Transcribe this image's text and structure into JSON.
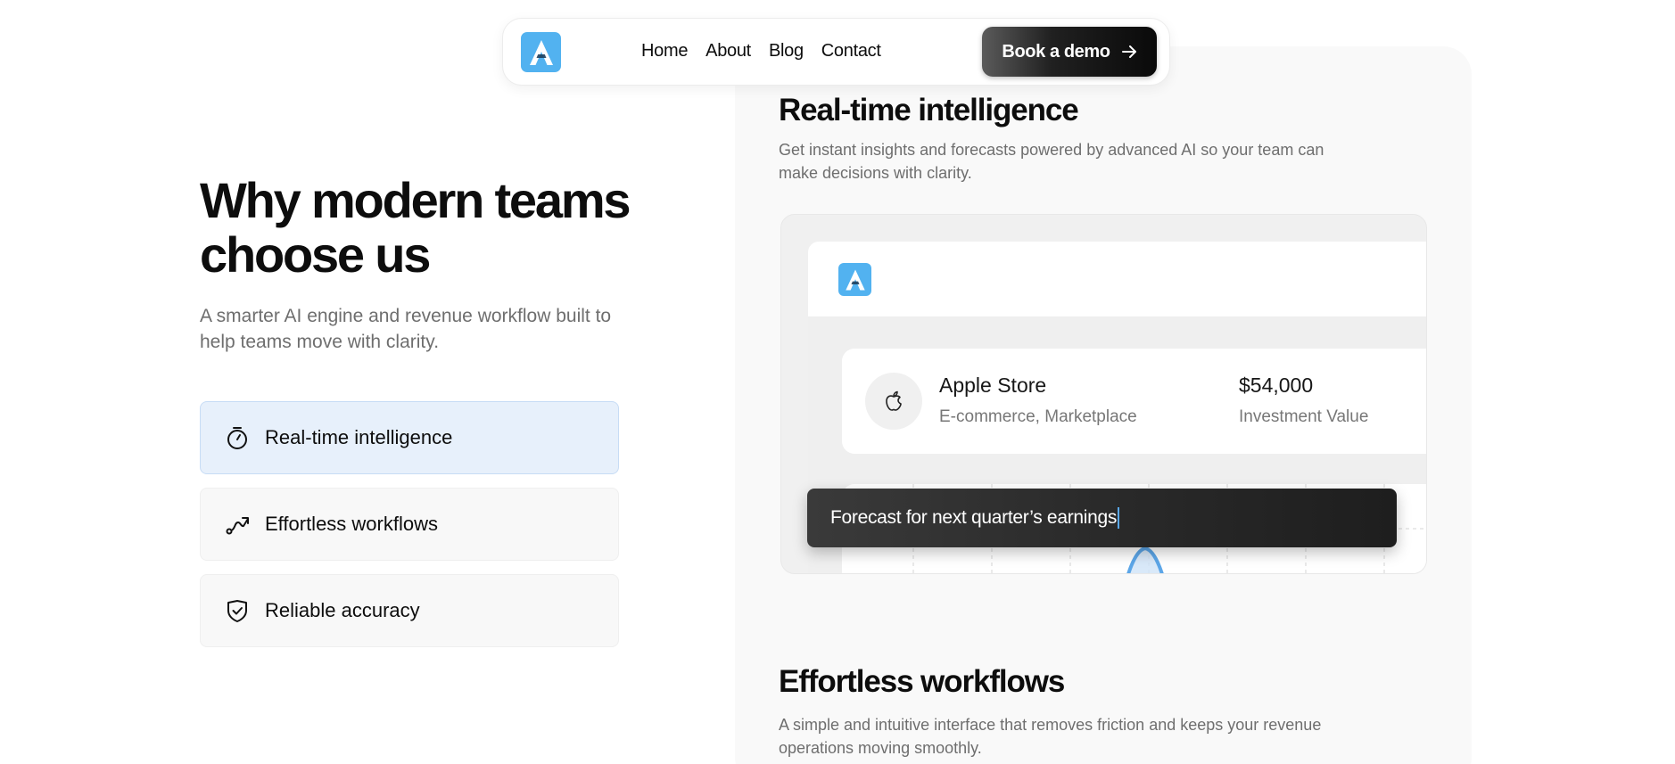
{
  "nav": {
    "links": [
      "Home",
      "About",
      "Blog",
      "Contact"
    ],
    "cta_label": "Book a demo"
  },
  "hero": {
    "title": "Why modern teams choose us",
    "subtitle": "A smarter AI engine and revenue workflow built to help teams move with clarity."
  },
  "features": [
    {
      "label": "Real-time intelligence",
      "icon": "stopwatch-icon",
      "active": true
    },
    {
      "label": "Effortless workflows",
      "icon": "route-arrow-icon",
      "active": false
    },
    {
      "label": "Reliable accuracy",
      "icon": "shield-check-icon",
      "active": false
    }
  ],
  "sections": [
    {
      "title": "Real-time intelligence",
      "description": "Get instant insights and forecasts powered by advanced AI so your team can make decisions with clarity."
    },
    {
      "title": "Effortless workflows",
      "description": "A simple and intuitive interface that removes friction and keeps your revenue operations moving smoothly."
    }
  ],
  "mockup": {
    "store": {
      "name": "Apple Store",
      "category": "E-commerce, Marketplace",
      "value": "$54,000",
      "value_label": "Investment Value",
      "icon": "apple-icon"
    },
    "prompt_text": "Forecast for next quarter’s earnings"
  },
  "colors": {
    "brand_blue": "#52b2f0",
    "active_feature_bg": "#e7f0fb",
    "text_muted": "#6e6e6e"
  }
}
